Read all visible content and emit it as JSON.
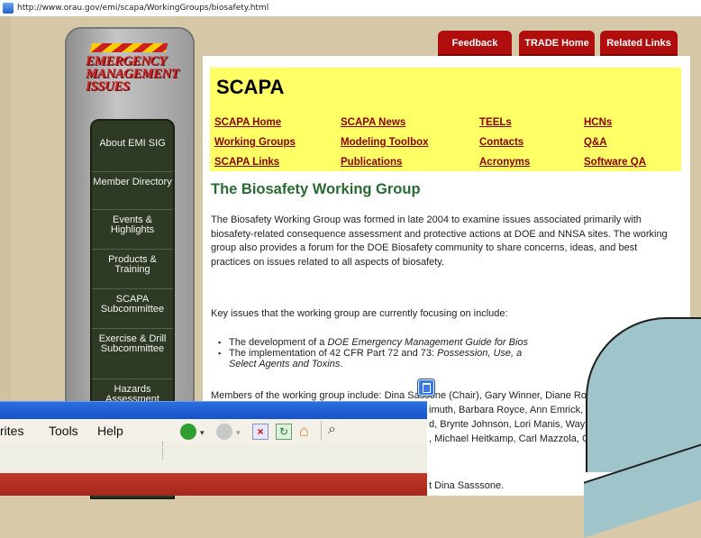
{
  "browser": {
    "url": "http://www.orau.gov/emi/scapa/WorkingGroups/biosafety.html",
    "menu_items": [
      "rites",
      "Tools",
      "Help"
    ]
  },
  "logo": {
    "lines": [
      "EMERGENCY",
      "MANAGEMENT",
      "ISSUES"
    ]
  },
  "sidebar": {
    "items": [
      {
        "label": "About EMI SIG"
      },
      {
        "label": "Member Directory"
      },
      {
        "label": "Events & Highlights"
      },
      {
        "label": "Products & Training"
      },
      {
        "label": "SCAPA Subcommittee"
      },
      {
        "label": "Exercise & Drill Subcommittee"
      },
      {
        "label": "Hazards Assessment"
      }
    ]
  },
  "tabs": {
    "feedback": "Feedback",
    "trade_home": "TRADE Home",
    "related_links": "Related Links"
  },
  "scapa": {
    "title": "SCAPA",
    "links": {
      "scapa_home": "SCAPA Home",
      "scapa_news": "SCAPA News",
      "teels": "TEELs",
      "hcns": "HCNs",
      "working_groups": "Working Groups",
      "modeling_toolbox": "Modeling Toolbox",
      "contacts": "Contacts",
      "qa": "Q&A",
      "scapa_links": "SCAPA Links",
      "publications": "Publications",
      "acronyms": "Acronyms",
      "software_qa": "Software QA"
    }
  },
  "article": {
    "heading": "The Biosafety Working Group",
    "p1": "The Biosafety Working Group was formed in late 2004 to examine issues associated primarily with biosafety-related consequence assessment and protective actions at DOE and NNSA sites.   The working group also provides a forum for the DOE Biosafety community to share concerns, ideas, and best practices on issues related to all aspects of biosafety.",
    "p2": "Key issues that the working group are currently focusing on include:",
    "bullet1_prefix": "The development of a ",
    "bullet1_italic": "DOE Emergency Management Guide for Bios",
    "bullet2_line1_prefix": "The implementation of 42 CFR Part 72 and 73: ",
    "bullet2_line1_italic": "Possession, Use, a",
    "bullet2_line2_italic": "Select Agents and Toxins",
    "bullet2_line2_suffix": ".",
    "members_line1": "Members of the working group include: Dina Sassone (Chair), Gary Winner, Diane Rodi,",
    "members_line2": "imuth, Barbara Royce, Ann Emrick, Fred Horn,",
    "members_line3": "d, Brynte Johnson, Lori Manis, Wayne Griest,",
    "members_line4": ", Michael Heitkamp, Carl Mazzola, Cliff Glantz,",
    "contact_tail": "t Dina Sasssone."
  }
}
